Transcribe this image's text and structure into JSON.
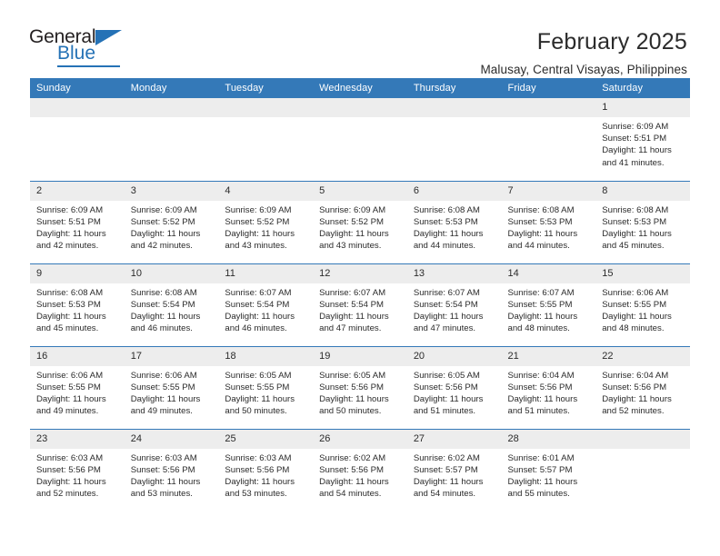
{
  "brand": {
    "name_top": "General",
    "name_bottom": "Blue",
    "accent_color": "#2572b6"
  },
  "header": {
    "title": "February 2025",
    "subtitle": "Malusay, Central Visayas, Philippines"
  },
  "theme": {
    "header_row_bg": "#3479b8",
    "daynum_bg": "#ededed",
    "text_color": "#2b2b2b",
    "grid_line": "#3479b8"
  },
  "calendar": {
    "weekday_headers": [
      "Sunday",
      "Monday",
      "Tuesday",
      "Wednesday",
      "Thursday",
      "Friday",
      "Saturday"
    ],
    "weeks": [
      [
        {
          "day": "",
          "blank": true
        },
        {
          "day": "",
          "blank": true
        },
        {
          "day": "",
          "blank": true
        },
        {
          "day": "",
          "blank": true
        },
        {
          "day": "",
          "blank": true
        },
        {
          "day": "",
          "blank": true
        },
        {
          "day": "1",
          "sunrise": "Sunrise: 6:09 AM",
          "sunset": "Sunset: 5:51 PM",
          "daylight_1": "Daylight: 11 hours",
          "daylight_2": "and 41 minutes."
        }
      ],
      [
        {
          "day": "2",
          "sunrise": "Sunrise: 6:09 AM",
          "sunset": "Sunset: 5:51 PM",
          "daylight_1": "Daylight: 11 hours",
          "daylight_2": "and 42 minutes."
        },
        {
          "day": "3",
          "sunrise": "Sunrise: 6:09 AM",
          "sunset": "Sunset: 5:52 PM",
          "daylight_1": "Daylight: 11 hours",
          "daylight_2": "and 42 minutes."
        },
        {
          "day": "4",
          "sunrise": "Sunrise: 6:09 AM",
          "sunset": "Sunset: 5:52 PM",
          "daylight_1": "Daylight: 11 hours",
          "daylight_2": "and 43 minutes."
        },
        {
          "day": "5",
          "sunrise": "Sunrise: 6:09 AM",
          "sunset": "Sunset: 5:52 PM",
          "daylight_1": "Daylight: 11 hours",
          "daylight_2": "and 43 minutes."
        },
        {
          "day": "6",
          "sunrise": "Sunrise: 6:08 AM",
          "sunset": "Sunset: 5:53 PM",
          "daylight_1": "Daylight: 11 hours",
          "daylight_2": "and 44 minutes."
        },
        {
          "day": "7",
          "sunrise": "Sunrise: 6:08 AM",
          "sunset": "Sunset: 5:53 PM",
          "daylight_1": "Daylight: 11 hours",
          "daylight_2": "and 44 minutes."
        },
        {
          "day": "8",
          "sunrise": "Sunrise: 6:08 AM",
          "sunset": "Sunset: 5:53 PM",
          "daylight_1": "Daylight: 11 hours",
          "daylight_2": "and 45 minutes."
        }
      ],
      [
        {
          "day": "9",
          "sunrise": "Sunrise: 6:08 AM",
          "sunset": "Sunset: 5:53 PM",
          "daylight_1": "Daylight: 11 hours",
          "daylight_2": "and 45 minutes."
        },
        {
          "day": "10",
          "sunrise": "Sunrise: 6:08 AM",
          "sunset": "Sunset: 5:54 PM",
          "daylight_1": "Daylight: 11 hours",
          "daylight_2": "and 46 minutes."
        },
        {
          "day": "11",
          "sunrise": "Sunrise: 6:07 AM",
          "sunset": "Sunset: 5:54 PM",
          "daylight_1": "Daylight: 11 hours",
          "daylight_2": "and 46 minutes."
        },
        {
          "day": "12",
          "sunrise": "Sunrise: 6:07 AM",
          "sunset": "Sunset: 5:54 PM",
          "daylight_1": "Daylight: 11 hours",
          "daylight_2": "and 47 minutes."
        },
        {
          "day": "13",
          "sunrise": "Sunrise: 6:07 AM",
          "sunset": "Sunset: 5:54 PM",
          "daylight_1": "Daylight: 11 hours",
          "daylight_2": "and 47 minutes."
        },
        {
          "day": "14",
          "sunrise": "Sunrise: 6:07 AM",
          "sunset": "Sunset: 5:55 PM",
          "daylight_1": "Daylight: 11 hours",
          "daylight_2": "and 48 minutes."
        },
        {
          "day": "15",
          "sunrise": "Sunrise: 6:06 AM",
          "sunset": "Sunset: 5:55 PM",
          "daylight_1": "Daylight: 11 hours",
          "daylight_2": "and 48 minutes."
        }
      ],
      [
        {
          "day": "16",
          "sunrise": "Sunrise: 6:06 AM",
          "sunset": "Sunset: 5:55 PM",
          "daylight_1": "Daylight: 11 hours",
          "daylight_2": "and 49 minutes."
        },
        {
          "day": "17",
          "sunrise": "Sunrise: 6:06 AM",
          "sunset": "Sunset: 5:55 PM",
          "daylight_1": "Daylight: 11 hours",
          "daylight_2": "and 49 minutes."
        },
        {
          "day": "18",
          "sunrise": "Sunrise: 6:05 AM",
          "sunset": "Sunset: 5:55 PM",
          "daylight_1": "Daylight: 11 hours",
          "daylight_2": "and 50 minutes."
        },
        {
          "day": "19",
          "sunrise": "Sunrise: 6:05 AM",
          "sunset": "Sunset: 5:56 PM",
          "daylight_1": "Daylight: 11 hours",
          "daylight_2": "and 50 minutes."
        },
        {
          "day": "20",
          "sunrise": "Sunrise: 6:05 AM",
          "sunset": "Sunset: 5:56 PM",
          "daylight_1": "Daylight: 11 hours",
          "daylight_2": "and 51 minutes."
        },
        {
          "day": "21",
          "sunrise": "Sunrise: 6:04 AM",
          "sunset": "Sunset: 5:56 PM",
          "daylight_1": "Daylight: 11 hours",
          "daylight_2": "and 51 minutes."
        },
        {
          "day": "22",
          "sunrise": "Sunrise: 6:04 AM",
          "sunset": "Sunset: 5:56 PM",
          "daylight_1": "Daylight: 11 hours",
          "daylight_2": "and 52 minutes."
        }
      ],
      [
        {
          "day": "23",
          "sunrise": "Sunrise: 6:03 AM",
          "sunset": "Sunset: 5:56 PM",
          "daylight_1": "Daylight: 11 hours",
          "daylight_2": "and 52 minutes."
        },
        {
          "day": "24",
          "sunrise": "Sunrise: 6:03 AM",
          "sunset": "Sunset: 5:56 PM",
          "daylight_1": "Daylight: 11 hours",
          "daylight_2": "and 53 minutes."
        },
        {
          "day": "25",
          "sunrise": "Sunrise: 6:03 AM",
          "sunset": "Sunset: 5:56 PM",
          "daylight_1": "Daylight: 11 hours",
          "daylight_2": "and 53 minutes."
        },
        {
          "day": "26",
          "sunrise": "Sunrise: 6:02 AM",
          "sunset": "Sunset: 5:56 PM",
          "daylight_1": "Daylight: 11 hours",
          "daylight_2": "and 54 minutes."
        },
        {
          "day": "27",
          "sunrise": "Sunrise: 6:02 AM",
          "sunset": "Sunset: 5:57 PM",
          "daylight_1": "Daylight: 11 hours",
          "daylight_2": "and 54 minutes."
        },
        {
          "day": "28",
          "sunrise": "Sunrise: 6:01 AM",
          "sunset": "Sunset: 5:57 PM",
          "daylight_1": "Daylight: 11 hours",
          "daylight_2": "and 55 minutes."
        },
        {
          "day": "",
          "blank": true
        }
      ]
    ]
  }
}
